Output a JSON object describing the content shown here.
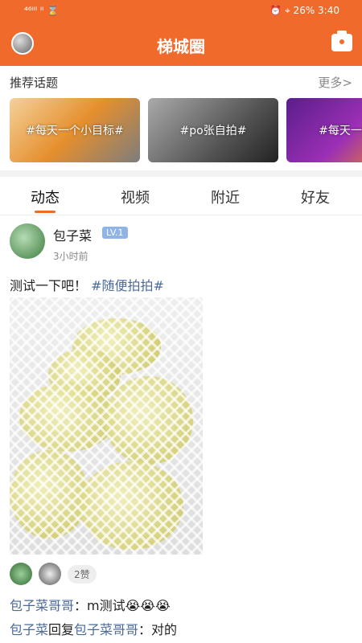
{
  "statusbar": {
    "left": "⁴⁶ᴵᴵˡ ᴵᴵ ⌛",
    "right": "⏰ ⌖ 26%  3:40"
  },
  "header": {
    "title": "梯城圈"
  },
  "topics": {
    "title": "推荐话题",
    "more": "更多>",
    "items": [
      {
        "label": "#每天一个小目标#"
      },
      {
        "label": "#po张自拍#"
      },
      {
        "label": "#每天一条微"
      }
    ]
  },
  "tabs": [
    "动态",
    "视频",
    "附近",
    "好友"
  ],
  "post": {
    "username": "包子菜",
    "level": "LV.1",
    "time": "3小时前",
    "text": "测试一下吧！",
    "tag": "#随便拍拍#",
    "likes": "2赞"
  },
  "comments": [
    {
      "name": "包子菜哥哥",
      "text": "：m测试😭😭😭"
    },
    {
      "name": "包子菜",
      "reply": "回复",
      "reply_to": "包子菜哥哥",
      "text": "：对的"
    }
  ],
  "colors": {
    "accent": "#f06a2c",
    "link": "#4b6a9a"
  },
  "icons": {
    "camera": "camera-icon",
    "chevron": "chevron-right-icon"
  }
}
